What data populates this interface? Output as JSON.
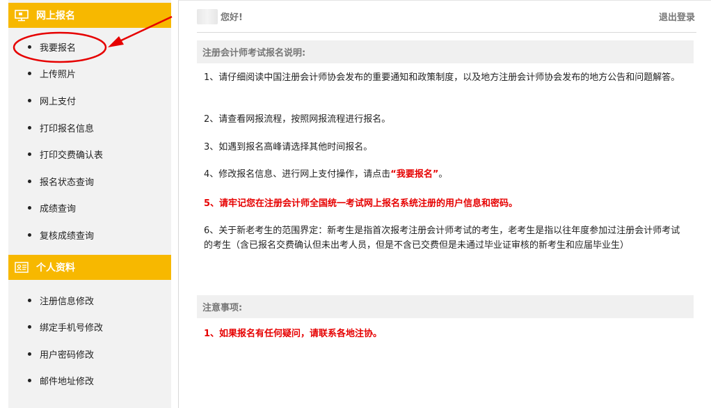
{
  "sidebar": {
    "section1": {
      "title": "网上报名",
      "icon": "monitor-icon"
    },
    "section1_items": [
      "我要报名",
      "上传照片",
      "网上支付",
      "打印报名信息",
      "打印交费确认表",
      "报名状态查询",
      "成绩查询",
      "复核成绩查询"
    ],
    "section2": {
      "title": "个人资料",
      "icon": "id-card-icon"
    },
    "section2_items": [
      "注册信息修改",
      "绑定手机号修改",
      "用户密码修改",
      "邮件地址修改"
    ]
  },
  "header": {
    "greeting": "您好!",
    "logout": "退出登录"
  },
  "instructions": {
    "title": "注册会计师考试报名说明:",
    "p1": "1、请仔细阅读中国注册会计师协会发布的重要通知和政策制度，以及地方注册会计师协会发布的地方公告和问题解答。",
    "p2": "2、请查看网报流程，按照网报流程进行报名。",
    "p3": "3、如遇到报名高峰请选择其他时间报名。",
    "p4_prefix": "4、修改报名信息、进行网上支付操作，请点击",
    "p4_link": "“我要报名”",
    "p4_suffix": "。",
    "p5_prefix": "5、",
    "p5_text": "请牢记您在注册会计师全国统一考试网上报名系统注册的用户信息和密码。",
    "p6": "6、关于新老考生的范围界定：新考生是指首次报考注册会计师考试的考生，老考生是指以往年度参加过注册会计师考试的考生（含已报名交费确认但未出考人员，但是不含已交费但是未通过毕业证审核的新考生和应届毕业生）"
  },
  "notes": {
    "title": "注意事项:",
    "n1": "1、如果报名有任何疑问，请联系各地注协。"
  },
  "colors": {
    "accent": "#f7b800",
    "annotation": "#e60000",
    "sidebar_bg": "#f2f2f2"
  }
}
